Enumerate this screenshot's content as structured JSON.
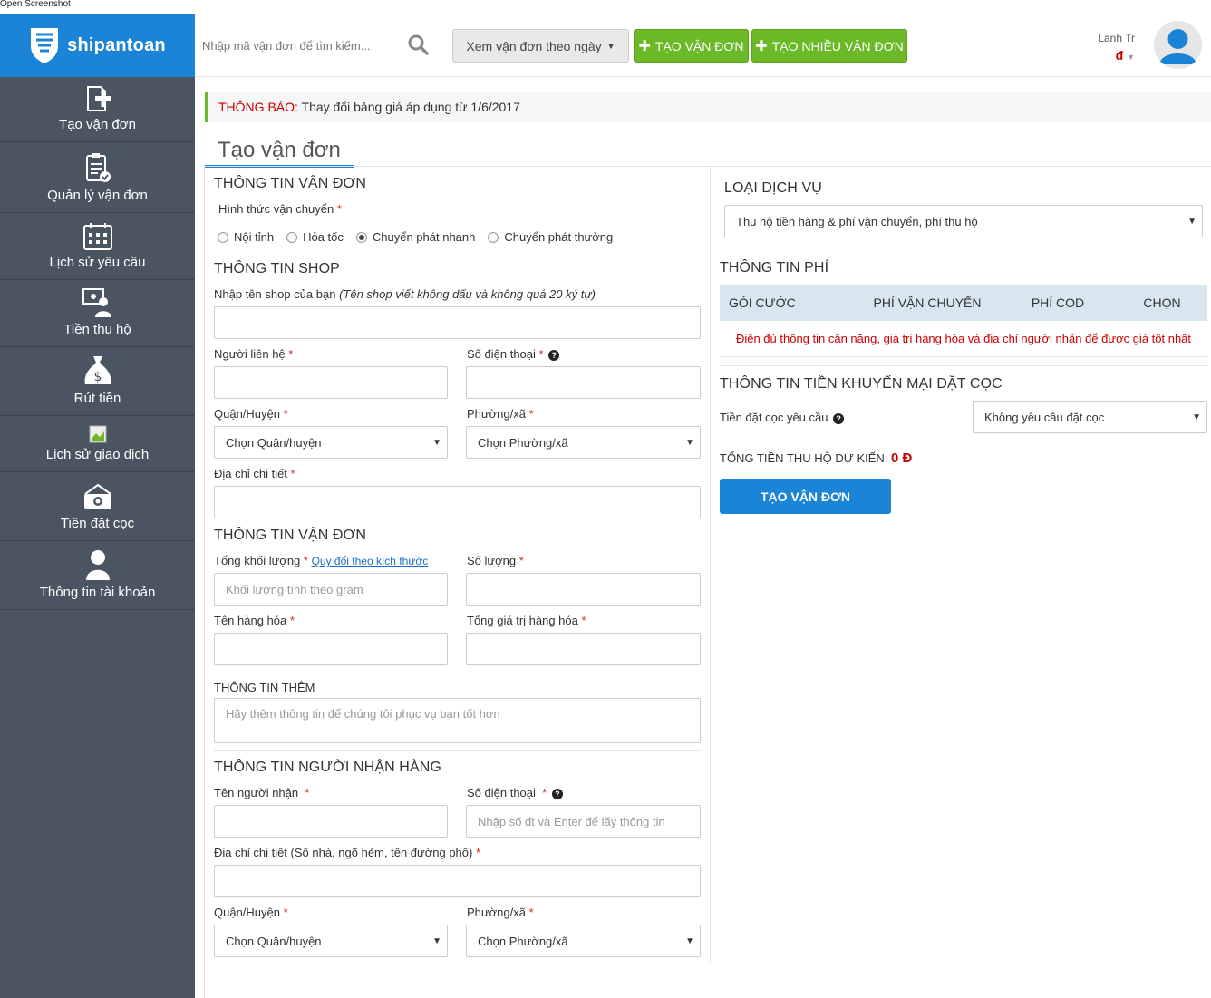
{
  "caption": "Open Screenshot",
  "brand": {
    "name": "shipantoan"
  },
  "sidebar": {
    "items": [
      {
        "label": "Tạo vận đơn",
        "icon": "new-document-icon"
      },
      {
        "label": "Quản lý vận đơn",
        "icon": "clipboard-check-icon"
      },
      {
        "label": "Lịch sử yêu cầu",
        "icon": "calendar-icon"
      },
      {
        "label": "Tiền thu hộ",
        "icon": "user-money-icon"
      },
      {
        "label": "Rút tiền",
        "icon": "money-bag-icon"
      },
      {
        "label": "Lịch sử giao dịch",
        "icon": "broken-image-icon"
      },
      {
        "label": "Tiền đặt cọc",
        "icon": "cash-icon"
      },
      {
        "label": "Thông tin tài khoản",
        "icon": "user-icon"
      }
    ]
  },
  "header": {
    "search_placeholder": "Nhập mã vận đơn để tìm kiếm...",
    "view_by_date": "Xem vận đơn theo ngày",
    "create_order": "TẠO VẬN ĐƠN",
    "create_multiple": "TẠO NHIỀU VẬN ĐƠN",
    "user_name": "Lanh Tr",
    "balance": "đ"
  },
  "notice": {
    "label": "THÔNG BÁO:",
    "text": "Thay đổi bảng giá áp dụng từ 1/6/2017"
  },
  "page_title": "Tạo vận đơn",
  "order_info": {
    "title": "THÔNG TIN VẬN ĐƠN",
    "shipping_method_label": "Hình thức vận chuyển",
    "required": "*",
    "methods": [
      "Nội tỉnh",
      "Hỏa tốc",
      "Chuyển phát nhanh",
      "Chuyển phát thường"
    ],
    "selected_method": "Chuyển phát nhanh"
  },
  "shop_info": {
    "title": "THÔNG TIN SHOP",
    "shop_name_label": "Nhập tên shop của bạn",
    "shop_name_hint": "(Tên shop viết không dấu và không quá 20 ký tự)",
    "contact_label": "Người liên hệ",
    "phone_label": "Số điện thoại",
    "district_label": "Quận/Huyện",
    "ward_label": "Phường/xã",
    "district_value": "Chọn Quận/huyện",
    "ward_value": "Chọn Phường/xã",
    "address_label": "Địa chỉ chi tiết"
  },
  "package_info": {
    "title": "THÔNG TIN VẬN ĐƠN",
    "weight_label": "Tổng khối lượng",
    "weight_link": "Quy đổi theo kích thước",
    "weight_placeholder": "Khối lượng tính theo gram",
    "quantity_label": "Số lượng",
    "goods_label": "Tên hàng hóa",
    "value_label": "Tổng giá trị hàng hóa",
    "extra_label": "THÔNG TIN THÊM",
    "extra_placeholder": "Hãy thêm thông tin để chúng tôi phục vụ bạn tốt hơn"
  },
  "receiver_info": {
    "title": "THÔNG TIN NGƯỜI NHẬN HÀNG",
    "name_label": "Tên người nhận",
    "phone_label": "Số điện thoại",
    "phone_placeholder": "Nhập số đt và Enter để lấy thông tin",
    "address_label": "Địa chỉ chi tiết (Số nhà, ngõ hẻm, tên đường phố)",
    "district_label": "Quận/Huyện",
    "ward_label": "Phường/xã",
    "district_value": "Chọn Quận/huyện",
    "ward_value": "Chọn Phường/xã"
  },
  "service": {
    "title": "LOẠI DỊCH VỤ",
    "selected": "Thu hộ tiền hàng & phí vận chuyển, phí thu hộ"
  },
  "fee_info": {
    "title": "THÔNG TIN PHÍ",
    "columns": [
      "GÓI CƯỚC",
      "PHÍ VẬN CHUYỂN",
      "PHÍ COD",
      "CHỌN"
    ],
    "message": "Điền đủ thông tin cân nặng, giá trị hàng hóa và địa chỉ người nhận để được giá tốt nhất"
  },
  "deposit": {
    "title": "THÔNG TIN TIỀN KHUYẾN MẠI ĐẶT CỌC",
    "label": "Tiền đặt cọc yêu cầu",
    "selected": "Không yêu cầu đặt cọc"
  },
  "total": {
    "label": "TỔNG TIỀN THU HỘ DỰ KIẾN:",
    "value": "0 Đ"
  },
  "submit_label": "TẠO VẬN ĐƠN",
  "colors": {
    "brand_blue": "#1b84d7",
    "sidebar": "#4b5561",
    "green": "#6bb927",
    "red": "#cc0000"
  }
}
